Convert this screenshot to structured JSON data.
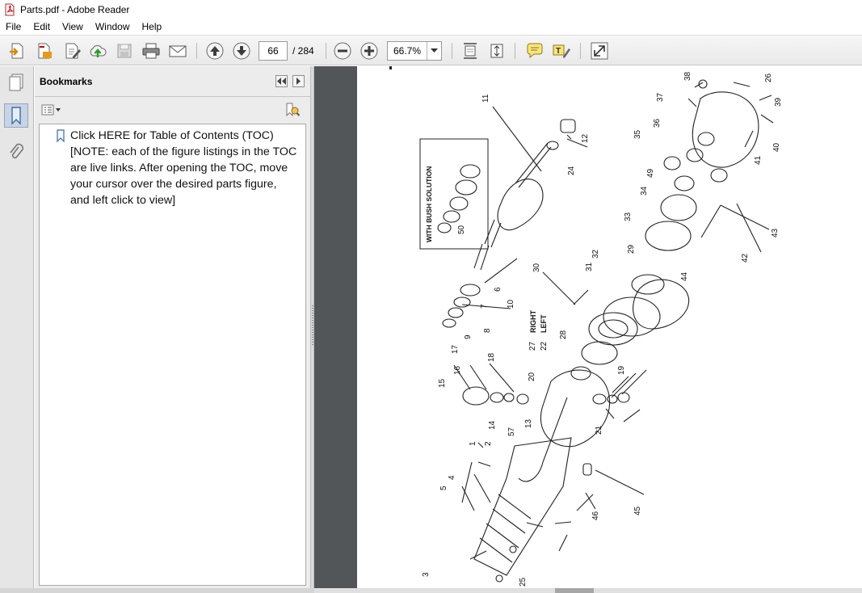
{
  "window": {
    "title": "Parts.pdf - Adobe Reader"
  },
  "menu": [
    "File",
    "Edit",
    "View",
    "Window",
    "Help"
  ],
  "toolbar": {
    "icons": [
      "create-pdf-icon",
      "export-pdf-icon",
      "edit-pdf-icon",
      "cloud-upload-icon",
      "save-icon",
      "print-icon",
      "email-icon",
      "previous-page-icon",
      "next-page-icon",
      "zoom-out-icon",
      "zoom-in-icon",
      "fit-page-icon",
      "scrolling-mode-icon",
      "comment-icon",
      "highlight-icon",
      "full-screen-icon"
    ],
    "page_current": "66",
    "page_total": "/ 284",
    "zoom": "66.7%"
  },
  "bookmarks": {
    "title": "Bookmarks",
    "items": [
      {
        "label": "Click HERE for Table of Contents (TOC) [NOTE: each of the figure listings in the TOC are live links. After opening the TOC, move your cursor over the desired parts figure, and left click to view]"
      }
    ]
  },
  "drawing": {
    "inset_label": "WITH BUSH SOLUTION",
    "side_labels": [
      "RIGHT",
      "LEFT"
    ],
    "callouts": [
      "1",
      "2",
      "3",
      "4",
      "5",
      "6",
      "7",
      "8",
      "9",
      "10",
      "11",
      "12",
      "13",
      "14",
      "15",
      "16",
      "17",
      "18",
      "19",
      "20",
      "21",
      "22",
      "24",
      "25",
      "26",
      "27",
      "28",
      "29",
      "30",
      "31",
      "32",
      "33",
      "34",
      "35",
      "36",
      "37",
      "38",
      "39",
      "40",
      "41",
      "42",
      "43",
      "44",
      "45",
      "46",
      "49",
      "50",
      "57"
    ]
  },
  "colors": {
    "document_background": "#525659",
    "toolbar_background": "#efefef",
    "panel_background": "#ececec"
  }
}
